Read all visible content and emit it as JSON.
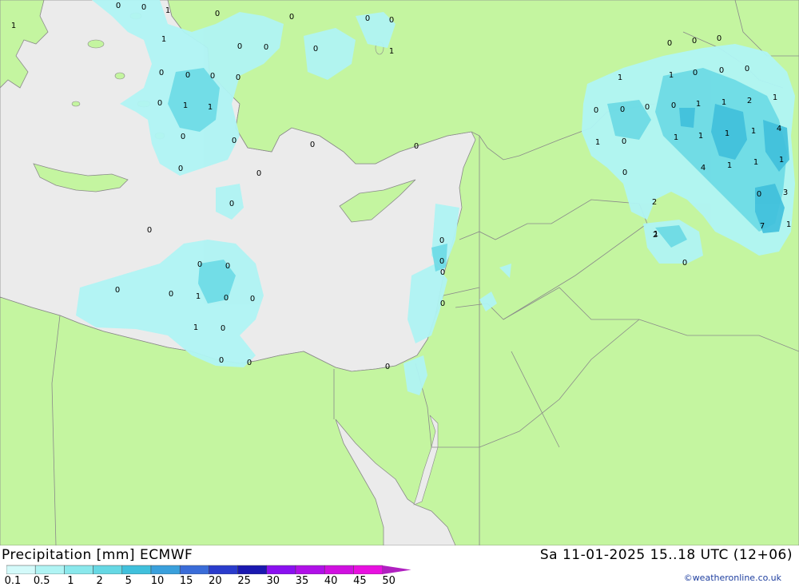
{
  "header": {
    "title": "Precipitation [mm] ECMWF",
    "datetime": "Sa 11-01-2025 15..18 UTC (12+06)"
  },
  "legend": {
    "labels": [
      "0.1",
      "0.5",
      "1",
      "2",
      "5",
      "10",
      "15",
      "20",
      "25",
      "30",
      "35",
      "40",
      "45",
      "50"
    ],
    "colors": [
      "#d4fafa",
      "#b0f4f4",
      "#8ae8ec",
      "#66d8e4",
      "#40c0dc",
      "#3aa0dc",
      "#3a6cd8",
      "#2a3ccc",
      "#1a18b0",
      "#8a10f0",
      "#b010e8",
      "#d010e0",
      "#e810e0",
      "#b020c0"
    ]
  },
  "credit": "©weatheronline.co.uk",
  "colors": {
    "land": "#c4f5a0",
    "sea": "#ebebeb",
    "border": "#8a8a8a"
  },
  "values": [
    {
      "t": "0"
    },
    {
      "t": "0"
    },
    {
      "t": "1"
    },
    {
      "t": "0"
    },
    {
      "t": "1"
    },
    {
      "t": "0"
    },
    {
      "t": "0"
    },
    {
      "t": "0"
    },
    {
      "t": "1"
    },
    {
      "t": "0"
    },
    {
      "t": "0"
    },
    {
      "t": "0"
    },
    {
      "t": "1"
    },
    {
      "t": "0"
    },
    {
      "t": "0"
    },
    {
      "t": "0"
    },
    {
      "t": "0"
    },
    {
      "t": "0"
    },
    {
      "t": "1"
    },
    {
      "t": "1"
    },
    {
      "t": "0"
    },
    {
      "t": "0"
    },
    {
      "t": "0"
    },
    {
      "t": "0"
    },
    {
      "t": "0"
    },
    {
      "t": "0"
    },
    {
      "t": "0"
    },
    {
      "t": "0"
    },
    {
      "t": "0"
    },
    {
      "t": "0"
    },
    {
      "t": "0"
    },
    {
      "t": "0"
    },
    {
      "t": "0"
    },
    {
      "t": "0"
    },
    {
      "t": "0"
    },
    {
      "t": "0"
    },
    {
      "t": "1"
    },
    {
      "t": "0"
    },
    {
      "t": "0"
    },
    {
      "t": "1"
    },
    {
      "t": "0"
    },
    {
      "t": "0"
    },
    {
      "t": "0"
    },
    {
      "t": "0"
    },
    {
      "t": "0"
    },
    {
      "t": "0"
    },
    {
      "t": "0"
    },
    {
      "t": "0"
    },
    {
      "t": "0"
    },
    {
      "t": "0"
    },
    {
      "t": "1"
    },
    {
      "t": "1"
    },
    {
      "t": "0"
    },
    {
      "t": "0"
    },
    {
      "t": "0"
    },
    {
      "t": "0"
    },
    {
      "t": "1"
    },
    {
      "t": "1"
    },
    {
      "t": "2"
    },
    {
      "t": "1"
    },
    {
      "t": "1"
    },
    {
      "t": "0"
    },
    {
      "t": "1"
    },
    {
      "t": "1"
    },
    {
      "t": "1"
    },
    {
      "t": "1"
    },
    {
      "t": "4"
    },
    {
      "t": "0"
    },
    {
      "t": "4"
    },
    {
      "t": "1"
    },
    {
      "t": "1"
    },
    {
      "t": "1"
    },
    {
      "t": "2"
    },
    {
      "t": "0"
    },
    {
      "t": "3"
    },
    {
      "t": "1"
    },
    {
      "t": "0"
    },
    {
      "t": "7"
    },
    {
      "t": "1"
    },
    {
      "t": "2"
    },
    {
      "t": "0"
    }
  ]
}
